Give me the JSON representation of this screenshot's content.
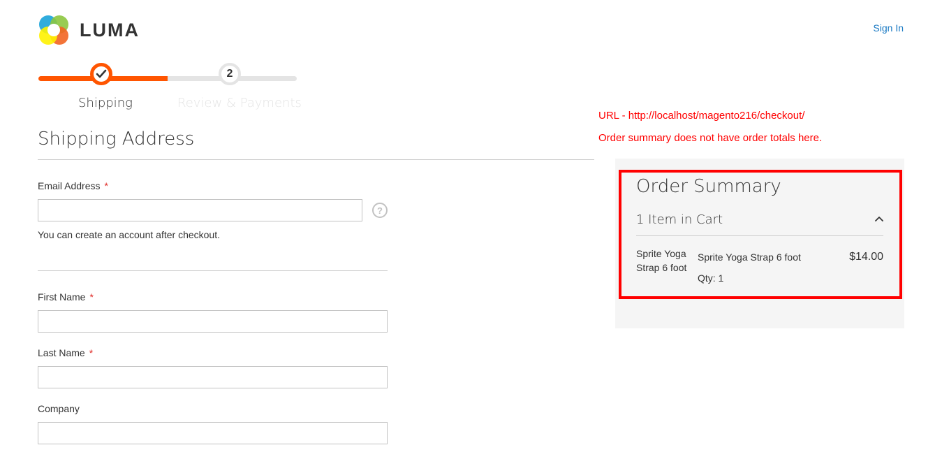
{
  "header": {
    "logo_text": "LUMA",
    "sign_in": "Sign In"
  },
  "progress": {
    "steps": [
      {
        "number": "",
        "label": "Shipping",
        "state": "complete"
      },
      {
        "number": "2",
        "label": "Review & Payments",
        "state": "inactive"
      }
    ]
  },
  "annotations": {
    "line1": "URL - http://localhost/magento216/checkout/",
    "line2": "Order summary does not have order totals here."
  },
  "shipping": {
    "title": "Shipping Address",
    "email_label": "Email Address",
    "email_value": "",
    "email_hint": "You can create an account after checkout.",
    "first_name_label": "First Name",
    "first_name_value": "",
    "last_name_label": "Last Name",
    "last_name_value": "",
    "company_label": "Company",
    "company_value": "",
    "required_mark": "*",
    "help_glyph": "?"
  },
  "summary": {
    "title": "Order Summary",
    "cart_count": "1 Item in Cart",
    "items": [
      {
        "thumb_alt": "Sprite Yoga Strap 6 foot",
        "name": "Sprite Yoga Strap 6 foot",
        "qty": "Qty: 1",
        "price": "$14.00"
      }
    ]
  },
  "colors": {
    "accent": "#ff5501",
    "link": "#1979c3",
    "annotation": "#ff0000",
    "required": "#e02b27"
  }
}
